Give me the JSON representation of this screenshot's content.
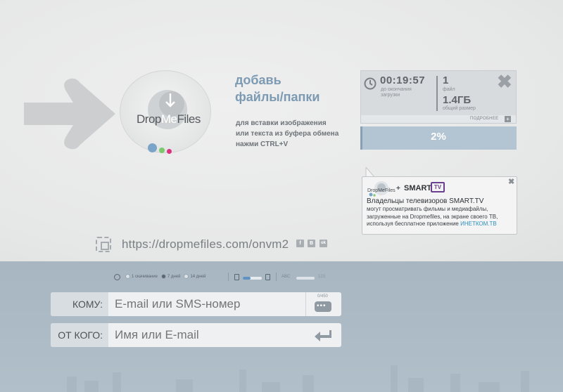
{
  "logo": {
    "drop": "Drop",
    "me": "Me",
    "files": "Files"
  },
  "add": {
    "title_line1": "добавь",
    "title_line2": "файлы/папки",
    "hint_line1": "для вставки изображения",
    "hint_line2": "или текста из буфера обмена",
    "hint_line3": "нажми CTRL+V"
  },
  "upload": {
    "time": "00:19:57",
    "time_sub1": "до окончания",
    "time_sub2": "загрузки",
    "files_count": "1",
    "files_label": "файл",
    "size": "1.4ГБ",
    "size_label": "общий размер",
    "more_label": "ПОДРОБНЕЕ",
    "more_plus": "+",
    "close": "✖",
    "progress": "2%"
  },
  "promo": {
    "plus": "+",
    "smart": "SMART",
    "tv": "TV",
    "close": "✖",
    "headline": "Владельцы телевизоров SMART.TV",
    "body_line1": "могут просматривать фильмы и медиафайлы,",
    "body_line2": "загруженные на Dropmefiles, на экране своего ТВ,",
    "body_line3": "используя бесплатное приложение ",
    "link": "ИНЕТКОМ.ТВ",
    "mini_logo": "DropMeFiles"
  },
  "share": {
    "url": "https://dropmefiles.com/onvm2",
    "social": [
      "f",
      "В",
      "ok"
    ]
  },
  "options": {
    "opt1": "1 скачивание",
    "opt2": "7 дней",
    "opt3": "14 дней",
    "selected": "7 дней",
    "abc": "ABC",
    "num": "123"
  },
  "form": {
    "to_label": "КОМУ:",
    "to_placeholder": "E-mail или SMS-номер",
    "from_label": "ОТ КОГО:",
    "from_placeholder": "Имя или E-mail",
    "sms_count": "0/450"
  },
  "colors": {
    "accent": "#7d9ab3",
    "progress": "#b3c4d2",
    "link": "#2b8fbf",
    "tv": "#6b3f8f"
  }
}
